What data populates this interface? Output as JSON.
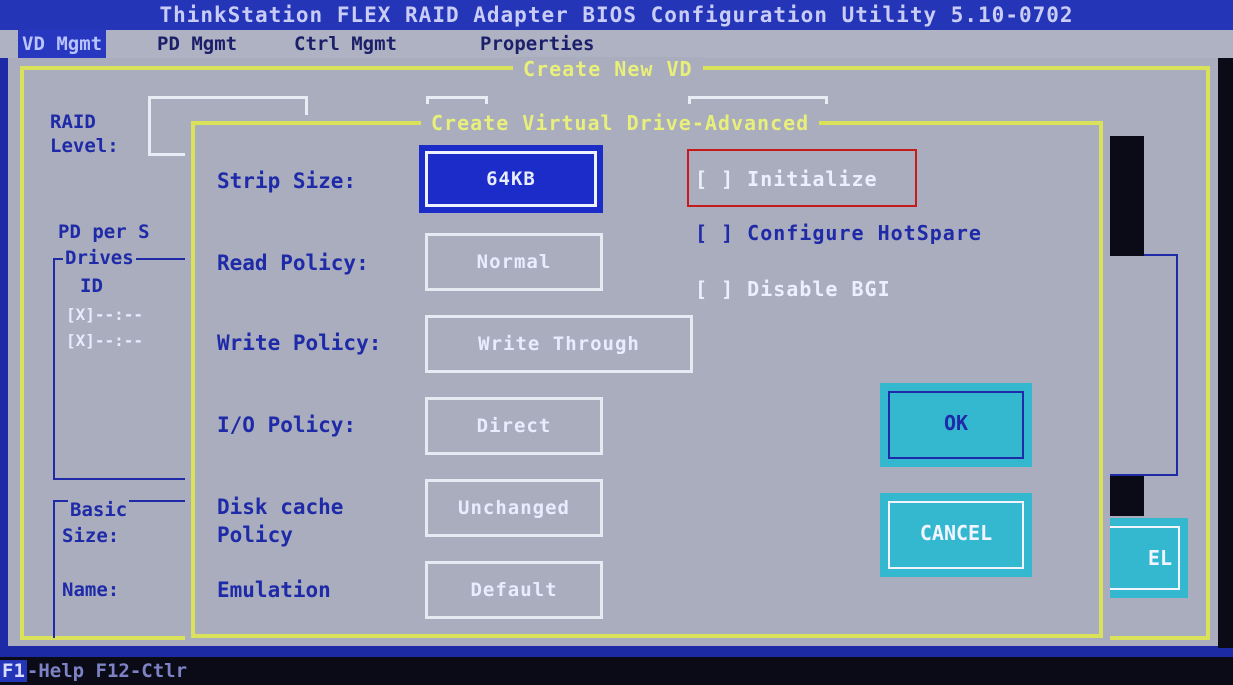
{
  "window": {
    "title": "ThinkStation FLEX RAID Adapter BIOS Configuration Utility 5.10-0702"
  },
  "menu": {
    "items": [
      "VD Mgmt",
      "PD Mgmt",
      "Ctrl Mgmt",
      "Properties"
    ],
    "active_index": 0
  },
  "outer_dialog": {
    "title": "Create New VD",
    "raid_level_label": "RAID\nLevel:",
    "pd_per_label": "PD per S",
    "drives_label": "Drives",
    "id_label": "ID",
    "drive_rows": [
      "[X]--:--",
      "[X]--:--"
    ],
    "basic_label": "Basic",
    "size_label": "Size:",
    "name_label": "Name:",
    "cancel_partial": "EL"
  },
  "advanced_dialog": {
    "title": "Create Virtual Drive-Advanced",
    "fields": [
      {
        "label": "Strip Size:",
        "value": "64KB"
      },
      {
        "label": "Read Policy:",
        "value": "Normal"
      },
      {
        "label": "Write Policy:",
        "value": "Write Through"
      },
      {
        "label": "I/O Policy:",
        "value": "Direct"
      },
      {
        "label": "Disk cache\nPolicy",
        "value": "Unchanged"
      },
      {
        "label": "Emulation",
        "value": "Default"
      }
    ],
    "checkboxes": [
      {
        "text": "[ ] Initialize",
        "highlighted": true
      },
      {
        "text": "[ ] Configure HotSpare"
      },
      {
        "text": "[ ] Disable BGI"
      }
    ],
    "ok_label": "OK",
    "cancel_label": "CANCEL"
  },
  "status": {
    "f1": "F1",
    "text": "-Help F12-Ctlr"
  },
  "colors": {
    "title_blue": "#2535b8",
    "panel_gray": "#a9adbd",
    "frame_yellow": "#d9e25a",
    "button_cyan": "#34b8d0",
    "highlight_red": "#c51b1b"
  }
}
